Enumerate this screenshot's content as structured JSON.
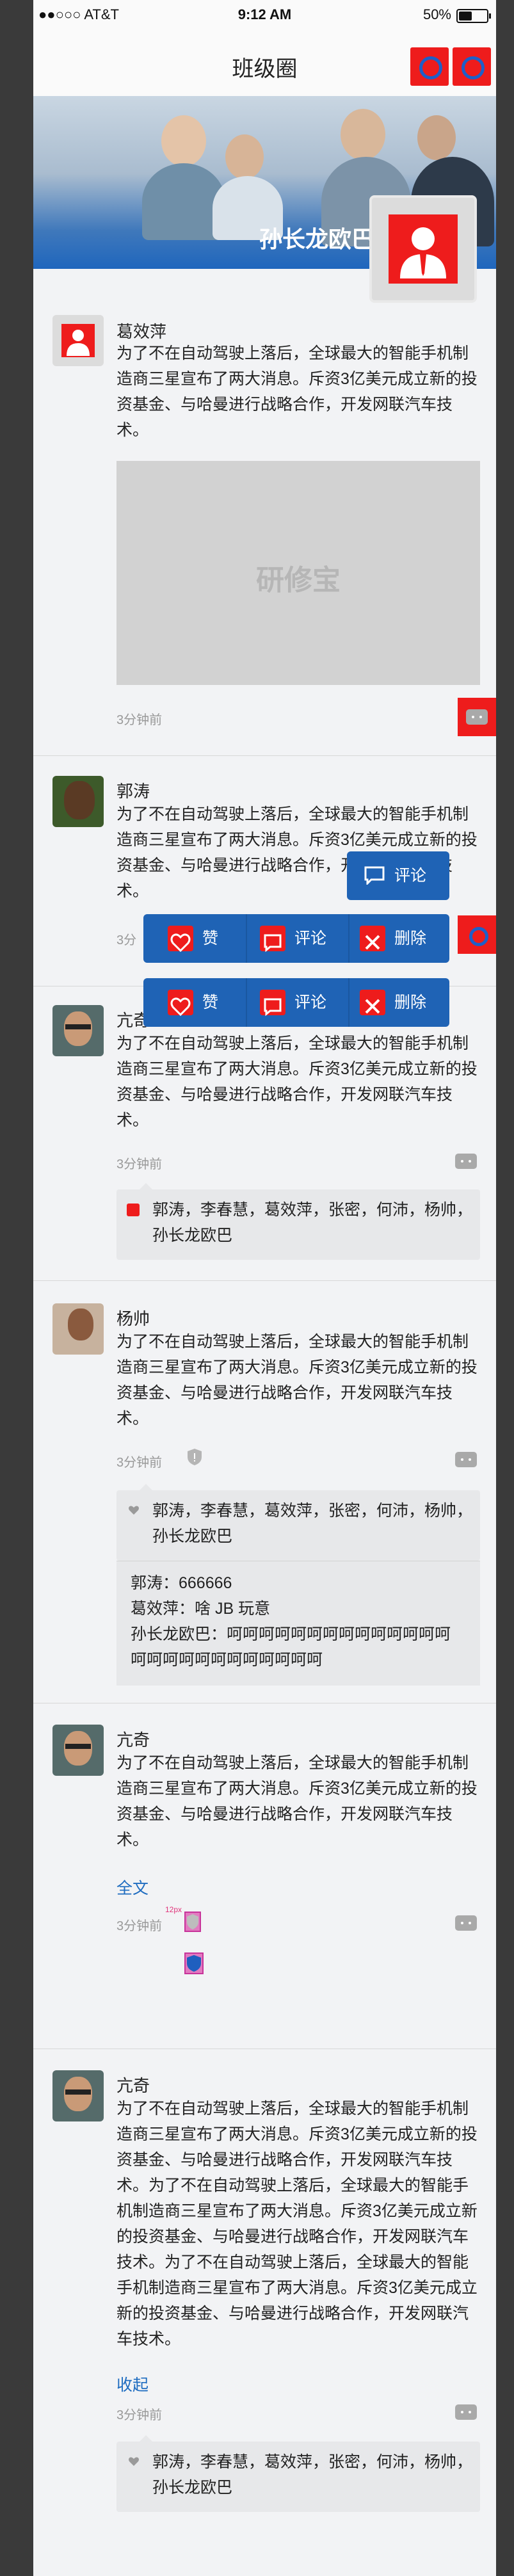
{
  "status_bar": {
    "carrier": "●●○○○ AT&T",
    "time": "9:12 AM",
    "battery": "50%",
    "battery_level": 0.5
  },
  "nav": {
    "title": "班级圈"
  },
  "banner": {
    "name": "孙长龙欧巴"
  },
  "posts": [
    {
      "name": "葛效萍",
      "content": "为了不在自动驾驶上落后，全球最大的智能手机制造商三星宣布了两大消息。斥资3亿美元成立新的投资基金、与哈曼进行战略合作，开发网联汽车技术。",
      "image_text": "研修宝",
      "time": "3分钟前"
    },
    {
      "name": "郭涛",
      "content": "为了不在自动驾驶上落后，全球最大的智能手机制造商三星宣布了两大消息。斥资3亿美元成立新的投资基金、与哈曼进行战略合作，开发网联汽车技术。",
      "time": "3分"
    },
    {
      "name": "亢奇",
      "content": "为了不在自动驾驶上落后，全球最大的智能手机制造商三星宣布了两大消息。斥资3亿美元成立新的投资基金、与哈曼进行战略合作，开发网联汽车技术。",
      "time": "3分钟前",
      "likes": "郭涛，李春慧，葛效萍，张密，何沛，杨帅，孙长龙欧巴"
    },
    {
      "name": "杨帅",
      "content": "为了不在自动驾驶上落后，全球最大的智能手机制造商三星宣布了两大消息。斥资3亿美元成立新的投资基金、与哈曼进行战略合作，开发网联汽车技术。",
      "time": "3分钟前",
      "likes": "郭涛，李春慧，葛效萍，张密，何沛，杨帅，孙长龙欧巴",
      "comments": [
        "郭涛：666666",
        "葛效萍：啥 JB 玩意",
        "孙长龙欧巴：呵呵呵呵呵呵呵呵呵呵呵呵呵呵呵呵呵呵呵呵呵呵呵呵呵呵"
      ]
    },
    {
      "name": "亢奇",
      "content": "为了不在自动驾驶上落后，全球最大的智能手机制造商三星宣布了两大消息。斥资3亿美元成立新的投资基金、与哈曼进行战略合作，开发网联汽车技术。",
      "expand": "全文",
      "time": "3分钟前",
      "annotation": "12px"
    },
    {
      "name": "亢奇",
      "content": "为了不在自动驾驶上落后，全球最大的智能手机制造商三星宣布了两大消息。斥资3亿美元成立新的投资基金、与哈曼进行战略合作，开发网联汽车技术。为了不在自动驾驶上落后，全球最大的智能手机制造商三星宣布了两大消息。斥资3亿美元成立新的投资基金、与哈曼进行战略合作，开发网联汽车技术。为了不在自动驾驶上落后，全球最大的智能手机制造商三星宣布了两大消息。斥资3亿美元成立新的投资基金、与哈曼进行战略合作，开发网联汽车技术。",
      "collapse": "收起",
      "time": "3分钟前",
      "likes": "郭涛，李春慧，葛效萍，张密，何沛，杨帅，孙长龙欧巴"
    }
  ],
  "popups": {
    "comment_only": "评论",
    "like": "赞",
    "comment": "评论",
    "delete": "删除"
  },
  "colors": {
    "accent": "#1f63b5",
    "red": "#ee1c1c",
    "link": "#1e6cc0"
  }
}
